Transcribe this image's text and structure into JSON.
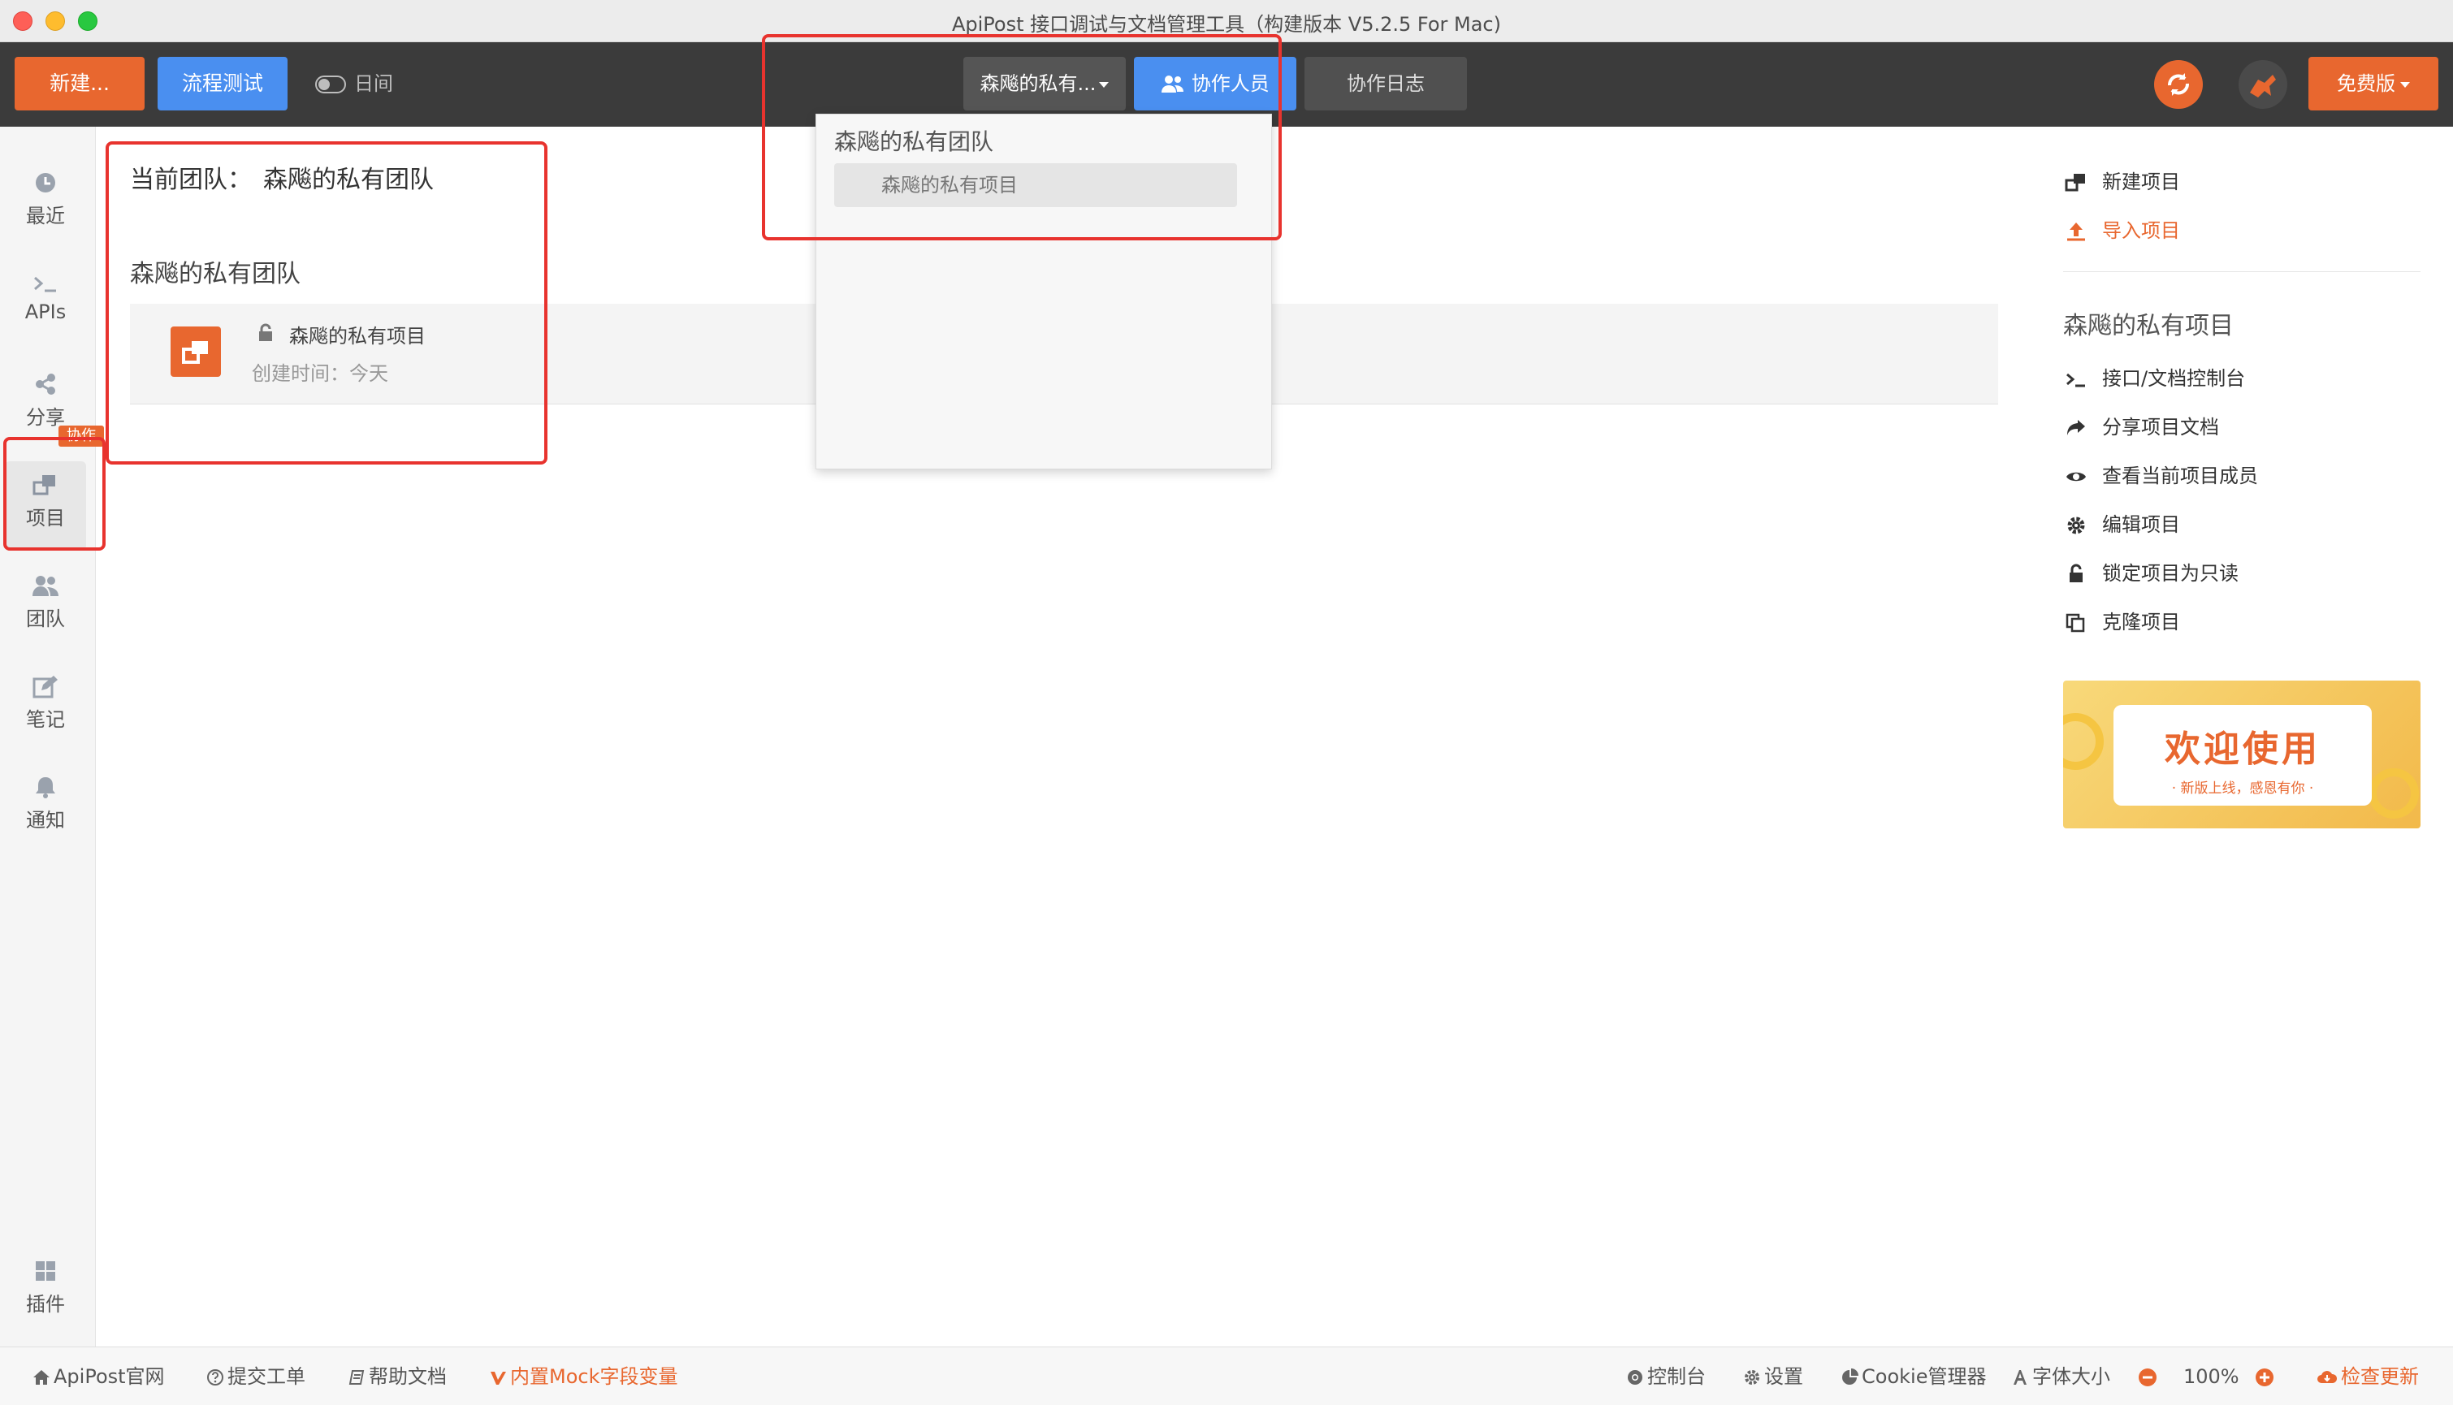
{
  "window": {
    "title": "ApiPost 接口调试与文档管理工具（构建版本 V5.2.5 For Mac)"
  },
  "toolbar": {
    "new_label": "新建...",
    "flow_label": "流程测试",
    "night_label": "日间",
    "team_select": "森飚的私有...",
    "collab_label": "协作人员",
    "log_label": "协作日志",
    "free_label": "免费版"
  },
  "sidebar": {
    "recent": "最近",
    "apis": "APIs",
    "share": "分享",
    "project": "项目",
    "team": "团队",
    "team_badge": "协作",
    "notes": "笔记",
    "notify": "通知",
    "plugins": "插件"
  },
  "main": {
    "current_team_label": "当前团队：",
    "current_team_value": "森飚的私有团队",
    "team_heading": "森飚的私有团队",
    "project": {
      "name": "森飚的私有项目",
      "created": "创建时间：今天"
    }
  },
  "dropdown": {
    "team": "森飚的私有团队",
    "project": "森飚的私有项目"
  },
  "right_panel": {
    "new_project": "新建项目",
    "import_project": "导入项目",
    "project_heading": "森飚的私有项目",
    "actions": [
      "接口/文档控制台",
      "分享项目文档",
      "查看当前项目成员",
      "编辑项目",
      "锁定项目为只读",
      "克隆项目"
    ],
    "banner_title": "欢迎使用",
    "banner_sub": "· 新版上线，感恩有你 ·"
  },
  "statusbar": {
    "site": "ApiPost官网",
    "ticket": "提交工单",
    "help": "帮助文档",
    "mock": "内置Mock字段变量",
    "console": "控制台",
    "settings": "设置",
    "cookie": "Cookie管理器",
    "font_size": "字体大小",
    "zoom": "100%",
    "update": "检查更新"
  },
  "colors": {
    "accent": "#e8672f",
    "primary": "#4a8ff0",
    "toolbar": "#3b3b3b",
    "annotation": "#e8332e"
  }
}
